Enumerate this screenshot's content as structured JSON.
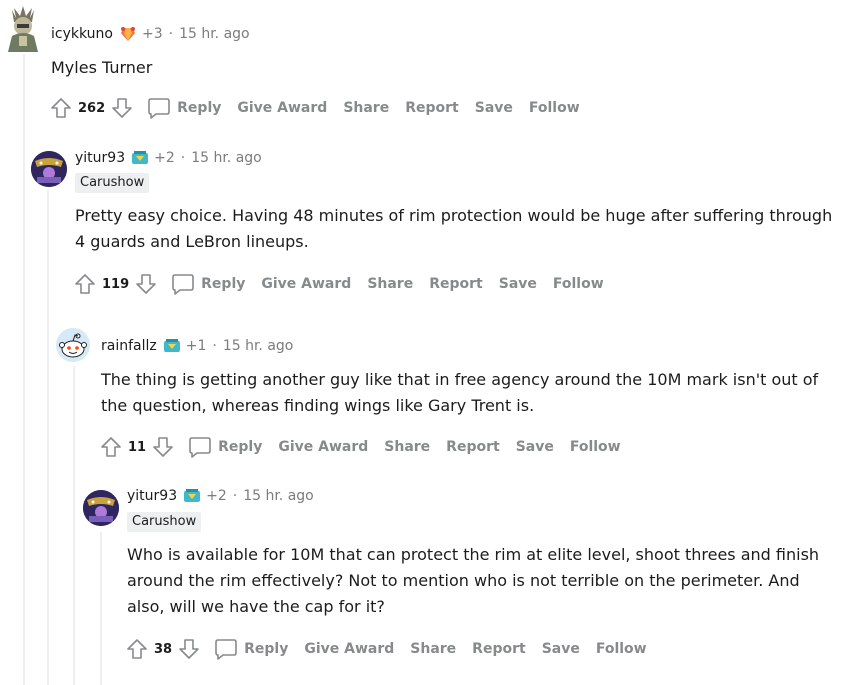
{
  "comments": [
    {
      "username": "icykkuno",
      "karma": "+3",
      "time": "15 hr. ago",
      "flair": "",
      "body": "Myles Turner",
      "score": "262",
      "actions": {
        "reply": "Reply",
        "give_award": "Give Award",
        "share": "Share",
        "report": "Report",
        "save": "Save",
        "follow": "Follow"
      }
    },
    {
      "username": "yitur93",
      "karma": "+2",
      "time": "15 hr. ago",
      "flair": "Carushow",
      "body": "Pretty easy choice. Having 48 minutes of rim protection would be huge after suffering through 4 guards and LeBron lineups.",
      "score": "119",
      "actions": {
        "reply": "Reply",
        "give_award": "Give Award",
        "share": "Share",
        "report": "Report",
        "save": "Save",
        "follow": "Follow"
      }
    },
    {
      "username": "rainfallz",
      "karma": "+1",
      "time": "15 hr. ago",
      "flair": "",
      "body": "The thing is getting another guy like that in free agency around the 10M mark isn't out of the question, whereas finding wings like Gary Trent is.",
      "score": "11",
      "actions": {
        "reply": "Reply",
        "give_award": "Give Award",
        "share": "Share",
        "report": "Report",
        "save": "Save",
        "follow": "Follow"
      }
    },
    {
      "username": "yitur93",
      "karma": "+2",
      "time": "15 hr. ago",
      "flair": "Carushow",
      "body": "Who is available for 10M that can protect the rim at elite level, shoot threes and finish around the rim effectively? Not to mention who is not terrible on the perimeter. And also, will we have the cap for it?",
      "score": "38",
      "actions": {
        "reply": "Reply",
        "give_award": "Give Award",
        "share": "Share",
        "report": "Report",
        "save": "Save",
        "follow": "Follow"
      }
    }
  ],
  "icons": {
    "upvote": "upvote-arrow-icon",
    "downvote": "downvote-arrow-icon",
    "reply": "speech-bubble-icon",
    "award": "flair-award-icon"
  },
  "colors": {
    "text": "#1c1c1c",
    "meta": "#7c7c7c",
    "action": "#878a8c",
    "flair_bg": "#edeff1",
    "thread_line": "#edeff1"
  }
}
